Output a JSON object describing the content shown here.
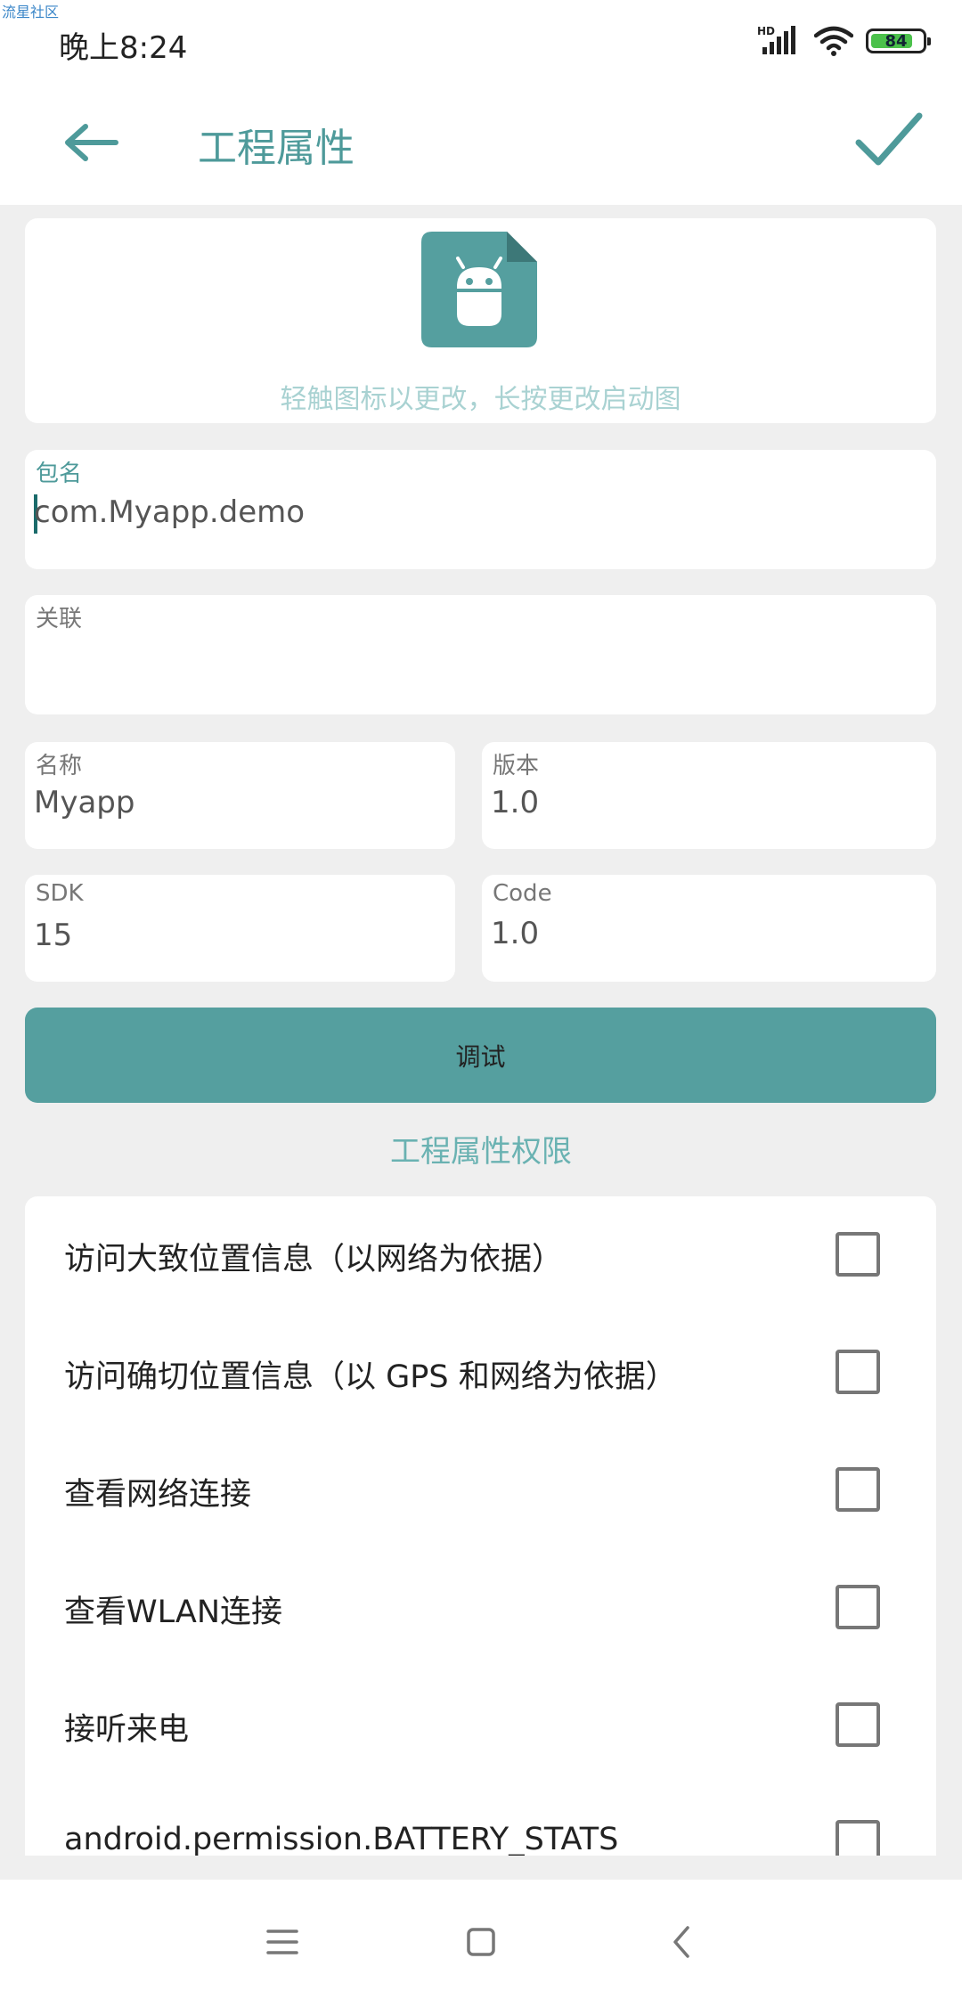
{
  "watermark": "流星社区",
  "status": {
    "time": "晚上8:24",
    "network": "HD",
    "battery": "84",
    "battery_level": 0.84
  },
  "appbar": {
    "title": "工程属性"
  },
  "icon_card": {
    "hint": "轻触图标以更改，长按更改启动图"
  },
  "fields": {
    "package": {
      "label": "包名",
      "value": "com.Myapp.demo"
    },
    "association": {
      "label": "关联",
      "value": ""
    },
    "name": {
      "label": "名称",
      "value": "Myapp"
    },
    "version": {
      "label": "版本",
      "value": "1.0"
    },
    "sdk": {
      "label": "SDK",
      "value": "15"
    },
    "code": {
      "label": "Code",
      "value": "1.0"
    }
  },
  "debug_button": "调试",
  "permissions_title": "工程属性权限",
  "permissions": [
    {
      "label": "访问大致位置信息（以网络为依据）",
      "checked": false
    },
    {
      "label": "访问确切位置信息（以 GPS 和网络为依据）",
      "checked": false
    },
    {
      "label": "查看网络连接",
      "checked": false
    },
    {
      "label": "查看WLAN连接",
      "checked": false
    },
    {
      "label": "接听来电",
      "checked": false
    },
    {
      "label": "android.permission.BATTERY_STATS",
      "checked": false
    }
  ],
  "colors": {
    "accent": "#4e9a9a",
    "button": "#559f9f",
    "battery": "#4bc14b"
  }
}
